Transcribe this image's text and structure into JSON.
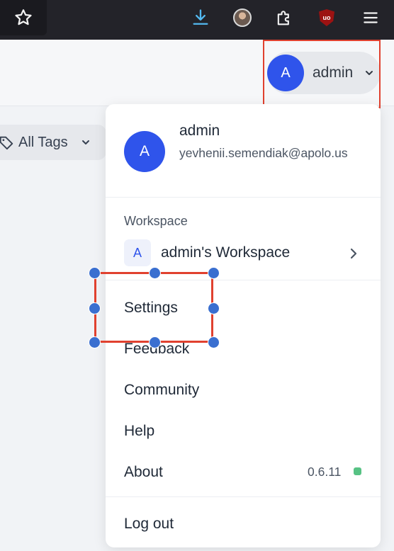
{
  "browser": {
    "icons": [
      "star-icon",
      "download-icon",
      "profile-avatar-icon",
      "extensions-puzzle-icon",
      "ublock-origin-icon",
      "hamburger-menu-icon"
    ],
    "ublock_text": "uo"
  },
  "header": {
    "user_chip": {
      "initial": "A",
      "name": "admin"
    }
  },
  "filters": {
    "tags_label": "All Tags"
  },
  "dropdown": {
    "profile": {
      "initial": "A",
      "name": "admin",
      "email": "yevhenii.semendiak@apolo.us"
    },
    "workspace": {
      "heading": "Workspace",
      "badge": "A",
      "name": "admin's Workspace"
    },
    "items": {
      "settings": "Settings",
      "feedback": "Feedback",
      "community": "Community",
      "help": "Help",
      "about": "About",
      "logout": "Log out"
    },
    "version": "0.6.11"
  },
  "colors": {
    "accent": "#2f54eb",
    "annotation_red": "#e0412f",
    "handle_blue": "#3a6fd0",
    "status_green": "#3ab76e"
  }
}
